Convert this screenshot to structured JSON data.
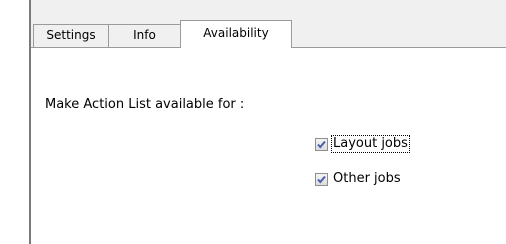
{
  "tabs": [
    {
      "label": "Settings",
      "active": false
    },
    {
      "label": "Info",
      "active": false
    },
    {
      "label": "Availability",
      "active": true
    }
  ],
  "availability": {
    "prompt": "Make Action List available for :",
    "options": [
      {
        "label": "Layout jobs",
        "checked": true,
        "focused": true
      },
      {
        "label": "Other jobs",
        "checked": true,
        "focused": false
      }
    ]
  },
  "colors": {
    "check_mark": "#4a5fa8",
    "tab_border": "#9a9a9a",
    "tab_background": "#f0f0f0"
  }
}
